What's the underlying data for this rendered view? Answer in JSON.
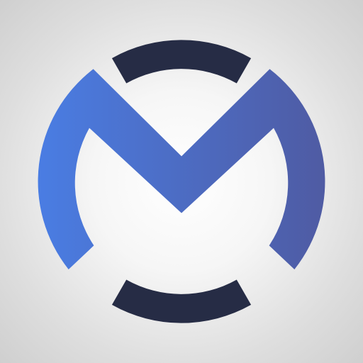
{
  "logo": {
    "icon": "m-circle-logo-icon",
    "colors": {
      "background_center": "#ffffff",
      "background_edge": "#cfcfcf",
      "gradient_start": "#4a7de3",
      "gradient_end": "#4f5ba3",
      "arc_dark": "#262c45"
    }
  }
}
